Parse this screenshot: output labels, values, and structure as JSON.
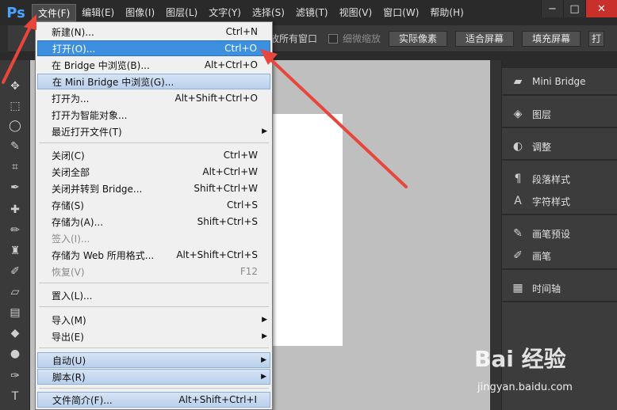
{
  "app": {
    "logo": "Ps",
    "menus": [
      "文件(F)",
      "编辑(E)",
      "图像(I)",
      "图层(L)",
      "文字(Y)",
      "选择(S)",
      "滤镜(T)",
      "视图(V)",
      "窗口(W)",
      "帮助(H)"
    ],
    "window_controls": {
      "minimize": "−",
      "maximize": "□",
      "close": "✕"
    }
  },
  "options_bar": {
    "partial_label": "放所有窗口",
    "checkbox_label": "细微缩放",
    "buttons": [
      "实际像素",
      "适合屏幕",
      "填充屏幕"
    ],
    "extra_button": "打"
  },
  "file_menu": {
    "items": [
      {
        "label": "新建(N)...",
        "shortcut": "Ctrl+N"
      },
      {
        "label": "打开(O)...",
        "shortcut": "Ctrl+O",
        "state": "highlighted"
      },
      {
        "label": "在 Bridge 中浏览(B)...",
        "shortcut": "Alt+Ctrl+O"
      },
      {
        "label": "在 Mini Bridge 中浏览(G)...",
        "shortcut": "",
        "state": "hover"
      },
      {
        "label": "打开为...",
        "shortcut": "Alt+Shift+Ctrl+O"
      },
      {
        "label": "打开为智能对象...",
        "shortcut": ""
      },
      {
        "label": "最近打开文件(T)",
        "shortcut": "",
        "submenu": true
      },
      {
        "label": "关闭(C)",
        "shortcut": "Ctrl+W"
      },
      {
        "label": "关闭全部",
        "shortcut": "Alt+Ctrl+W"
      },
      {
        "label": "关闭并转到 Bridge...",
        "shortcut": "Shift+Ctrl+W"
      },
      {
        "label": "存储(S)",
        "shortcut": "Ctrl+S"
      },
      {
        "label": "存储为(A)...",
        "shortcut": "Shift+Ctrl+S"
      },
      {
        "label": "签入(I)...",
        "shortcut": "",
        "disabled": true
      },
      {
        "label": "存储为 Web 所用格式...",
        "shortcut": "Alt+Shift+Ctrl+S"
      },
      {
        "label": "恢复(V)",
        "shortcut": "F12",
        "disabled": true
      },
      {
        "label": "置入(L)...",
        "shortcut": ""
      },
      {
        "label": "导入(M)",
        "shortcut": "",
        "submenu": true
      },
      {
        "label": "导出(E)",
        "shortcut": "",
        "submenu": true
      },
      {
        "label": "自动(U)",
        "shortcut": "",
        "submenu": true,
        "state": "hover"
      },
      {
        "label": "脚本(R)",
        "shortcut": "",
        "submenu": true,
        "state": "hover"
      },
      {
        "label": "文件简介(F)...",
        "shortcut": "Alt+Shift+Ctrl+I",
        "state": "hover"
      }
    ]
  },
  "right_panels": [
    {
      "label": "Mini Bridge",
      "icon": "mini-bridge-icon"
    },
    {
      "label": "图层",
      "icon": "layers-icon"
    },
    {
      "label": "调整",
      "icon": "adjustments-icon"
    },
    {
      "label": "段落样式",
      "icon": "paragraph-styles-icon"
    },
    {
      "label": "字符样式",
      "icon": "character-styles-icon"
    },
    {
      "label": "画笔预设",
      "icon": "brush-presets-icon"
    },
    {
      "label": "画笔",
      "icon": "brush-icon"
    },
    {
      "label": "时间轴",
      "icon": "timeline-icon"
    }
  ],
  "watermark": {
    "top": "Bai 经验",
    "bottom": "jingyan.baidu.com"
  },
  "colors": {
    "accent_highlight": "#3d8fe0",
    "arrow": "#e8463c",
    "ps_blue": "#4aa3ff"
  }
}
